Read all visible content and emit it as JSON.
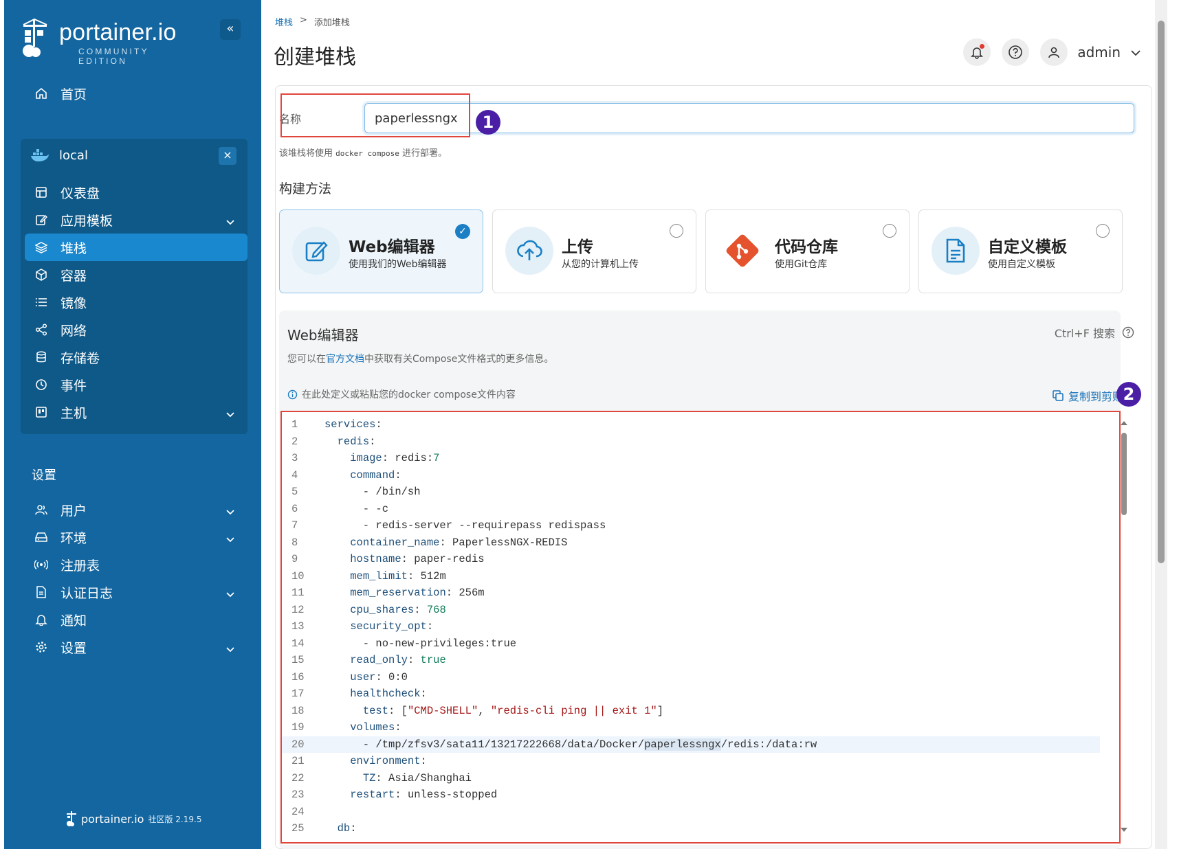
{
  "sidebar": {
    "brand": "portainer.io",
    "edition": "COMMUNITY EDITION",
    "collapse": "«",
    "home": "首页",
    "environment": {
      "name": "local",
      "close": "×"
    },
    "env_items": [
      {
        "label": "仪表盘"
      },
      {
        "label": "应用模板"
      },
      {
        "label": "堆栈"
      },
      {
        "label": "容器"
      },
      {
        "label": "镜像"
      },
      {
        "label": "网络"
      },
      {
        "label": "存储卷"
      },
      {
        "label": "事件"
      },
      {
        "label": "主机"
      }
    ],
    "settings_title": "设置",
    "settings_items": [
      {
        "label": "用户"
      },
      {
        "label": "环境"
      },
      {
        "label": "注册表"
      },
      {
        "label": "认证日志"
      },
      {
        "label": "通知"
      },
      {
        "label": "设置"
      }
    ],
    "footer_brand": "portainer.io",
    "footer_version": "社区版 2.19.5"
  },
  "header": {
    "breadcrumb_link": "堆栈",
    "breadcrumb_sep": ">",
    "breadcrumb_current": "添加堆栈",
    "title": "创建堆栈",
    "user": "admin"
  },
  "form": {
    "name_label": "名称",
    "name_value": "paperlessngx",
    "hint_prefix": "该堆栈将使用 ",
    "hint_code": "docker compose",
    "hint_suffix": " 进行部署。",
    "build_method_title": "构建方法",
    "methods": [
      {
        "title": "Web编辑器",
        "subtitle": "使用我们的Web编辑器"
      },
      {
        "title": "上传",
        "subtitle": "从您的计算机上传"
      },
      {
        "title": "代码仓库",
        "subtitle": "使用Git仓库"
      },
      {
        "title": "自定义模板",
        "subtitle": "使用自定义模板"
      }
    ]
  },
  "annotations": {
    "badge1": "1",
    "badge2": "2"
  },
  "editor": {
    "title": "Web编辑器",
    "search_hint": "Ctrl+F 搜索",
    "desc_prefix": "您可以在",
    "desc_link": "官方文档",
    "desc_suffix": "中获取有关Compose文件格式的更多信息。",
    "info": "在此处定义或粘贴您的docker compose文件内容",
    "copy": "复制到剪贴",
    "lines": [
      "services:",
      "  redis:",
      "    image: redis:7",
      "    command:",
      "      - /bin/sh",
      "      - -c",
      "      - redis-server --requirepass redispass",
      "    container_name: PaperlessNGX-REDIS",
      "    hostname: paper-redis",
      "    mem_limit: 512m",
      "    mem_reservation: 256m",
      "    cpu_shares: 768",
      "    security_opt:",
      "      - no-new-privileges:true",
      "    read_only: true",
      "    user: 0:0",
      "    healthcheck:",
      "      test: [\"CMD-SHELL\", \"redis-cli ping || exit 1\"]",
      "    volumes:",
      "      - /tmp/zfsv3/sata11/13217222668/data/Docker/paperlessngx/redis:/data:rw",
      "    environment:",
      "      TZ: Asia/Shanghai",
      "    restart: unless-stopped",
      "",
      "  db:"
    ]
  },
  "colors": {
    "sidebar_bg": "#13669f",
    "sidebar_active": "#1a88cf",
    "accent": "#1a7fc4",
    "annotation_red": "#e0463a",
    "annotation_badge": "#4a1fa6",
    "git_orange": "#e4532d"
  }
}
